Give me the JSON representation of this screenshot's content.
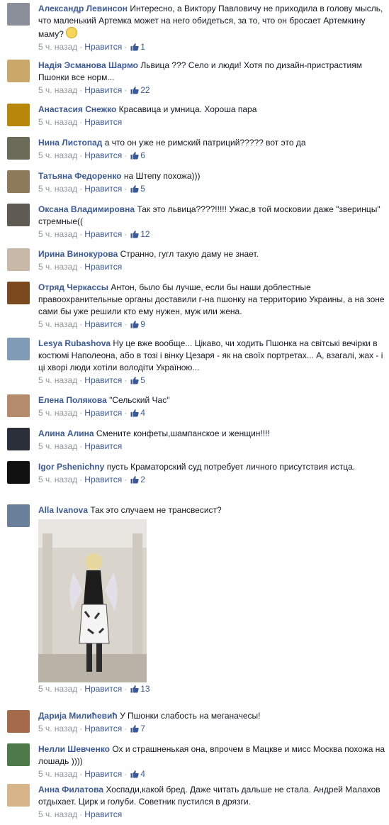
{
  "ui": {
    "time_ago": "5 ч. назад",
    "like": "Нравится"
  },
  "comments": [
    {
      "author": "Александр Левинсон",
      "text": "Интересно, а Виктору Павловичу не приходила в голову мысль, что маленький Артемка может на него обидеться, за то, что он бросает Артемкину маму?",
      "likes": "1",
      "avatar_color": "#8a8f9a"
    },
    {
      "author": "Надія Эсманова Шармо",
      "text": "Львица ??? Село и люди! Хотя по дизайн-пристрастиям Пшонки все норм...",
      "likes": "22",
      "avatar_color": "#c9a86a"
    },
    {
      "author": "Анастасия Снежко",
      "text": "Красавица и умница. Хороша пара",
      "likes": "",
      "avatar_color": "#b8860b"
    },
    {
      "author": "Нина Листопад",
      "text": "а что он уже не римский патриций????? вот это да",
      "likes": "6",
      "avatar_color": "#6b6b5a"
    },
    {
      "author": "Татьяна Федоренко",
      "text": "на Штепу похожа)))",
      "likes": "5",
      "avatar_color": "#8c7a5b"
    },
    {
      "author": "Оксана Владимировна",
      "text": "Так это львица????!!!!! Ужас,в той московии даже \"зверинцы\" стремные((",
      "likes": "12",
      "avatar_color": "#5f5a52"
    },
    {
      "author": "Ирина Винокурова",
      "text": "Странно, гугл такую даму не знает.",
      "likes": "",
      "avatar_color": "#c7b8a8"
    },
    {
      "author": "Отряд Черкассы",
      "text": "Антон, было бы лучше, если бы наши доблестные правоохранительные органы доставили г-на пшонку на территорию Украины, а на зоне сами бы уже решили кто ему нужен, муж или жена.",
      "likes": "9",
      "avatar_color": "#7a4a1e"
    },
    {
      "author": "Lesya Rubashova",
      "text": "Ну це вже вообще... Цікаво, чи ходить Пшонка на світські вечірки в костюмі Наполеона, або в тозі і вінку Цезаря - як на своїх портретах... А, взагалі, жах - і ці хворі люди хотіли володіти Україною...",
      "likes": "5",
      "avatar_color": "#7f9bb5"
    },
    {
      "author": "Елена Полякова",
      "text": "\"Сельский Час\"",
      "likes": "4",
      "avatar_color": "#b58c6b"
    },
    {
      "author": "Алина Алина",
      "text": "Смените конфеты,шампанское и женщин!!!!",
      "likes": "",
      "avatar_color": "#2a2f3a"
    },
    {
      "author": "Igor Pshenichny",
      "text": "пусть Краматорский суд потребует личного присутствия истца.",
      "likes": "2",
      "avatar_color": "#111111"
    },
    {
      "author": "Alla Ivanova",
      "text": "Так это случаем не трансвесист?",
      "likes": "13",
      "avatar_color": "#6a7f9a"
    },
    {
      "author": "Дарија Милићевић",
      "text": "У Пшонки слабость на меганачесы!",
      "likes": "7",
      "avatar_color": "#a56a4a"
    },
    {
      "author": "Нелли Шевченко",
      "text": "Ох и страшненькая она, впрочем в Мацкве и мисс Москва похожа на лошадь ))))",
      "likes": "4",
      "avatar_color": "#4e7a4a"
    },
    {
      "author": "Анна Филатова",
      "text": "Хоспади,какой бред. Даже читать дальше не стала. Андрей Малахов отдыхает. Цирк и голуби. Советник пустился в дрязги.",
      "likes": "",
      "avatar_color": "#d8b48a"
    }
  ]
}
